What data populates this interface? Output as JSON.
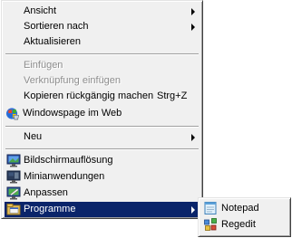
{
  "context_menu": {
    "view": "Ansicht",
    "sort_by": "Sortieren nach",
    "refresh": "Aktualisieren",
    "paste": "Einfügen",
    "paste_shortcut": "Verknüpfung einfügen",
    "undo_copy": "Kopieren rückgängig machen",
    "undo_copy_shortcut": "Strg+Z",
    "windows_page": "Windowspage im Web",
    "new": "Neu",
    "screen_resolution": "Bildschirmauflösung",
    "gadgets": "Minianwendungen",
    "personalize": "Anpassen",
    "programs": "Programme"
  },
  "submenu": {
    "notepad": "Notepad",
    "regedit": "Regedit"
  },
  "colors": {
    "menu_bg": "#f0f0f0",
    "selection": "#0a246a",
    "disabled_text": "#8d8d8d"
  }
}
